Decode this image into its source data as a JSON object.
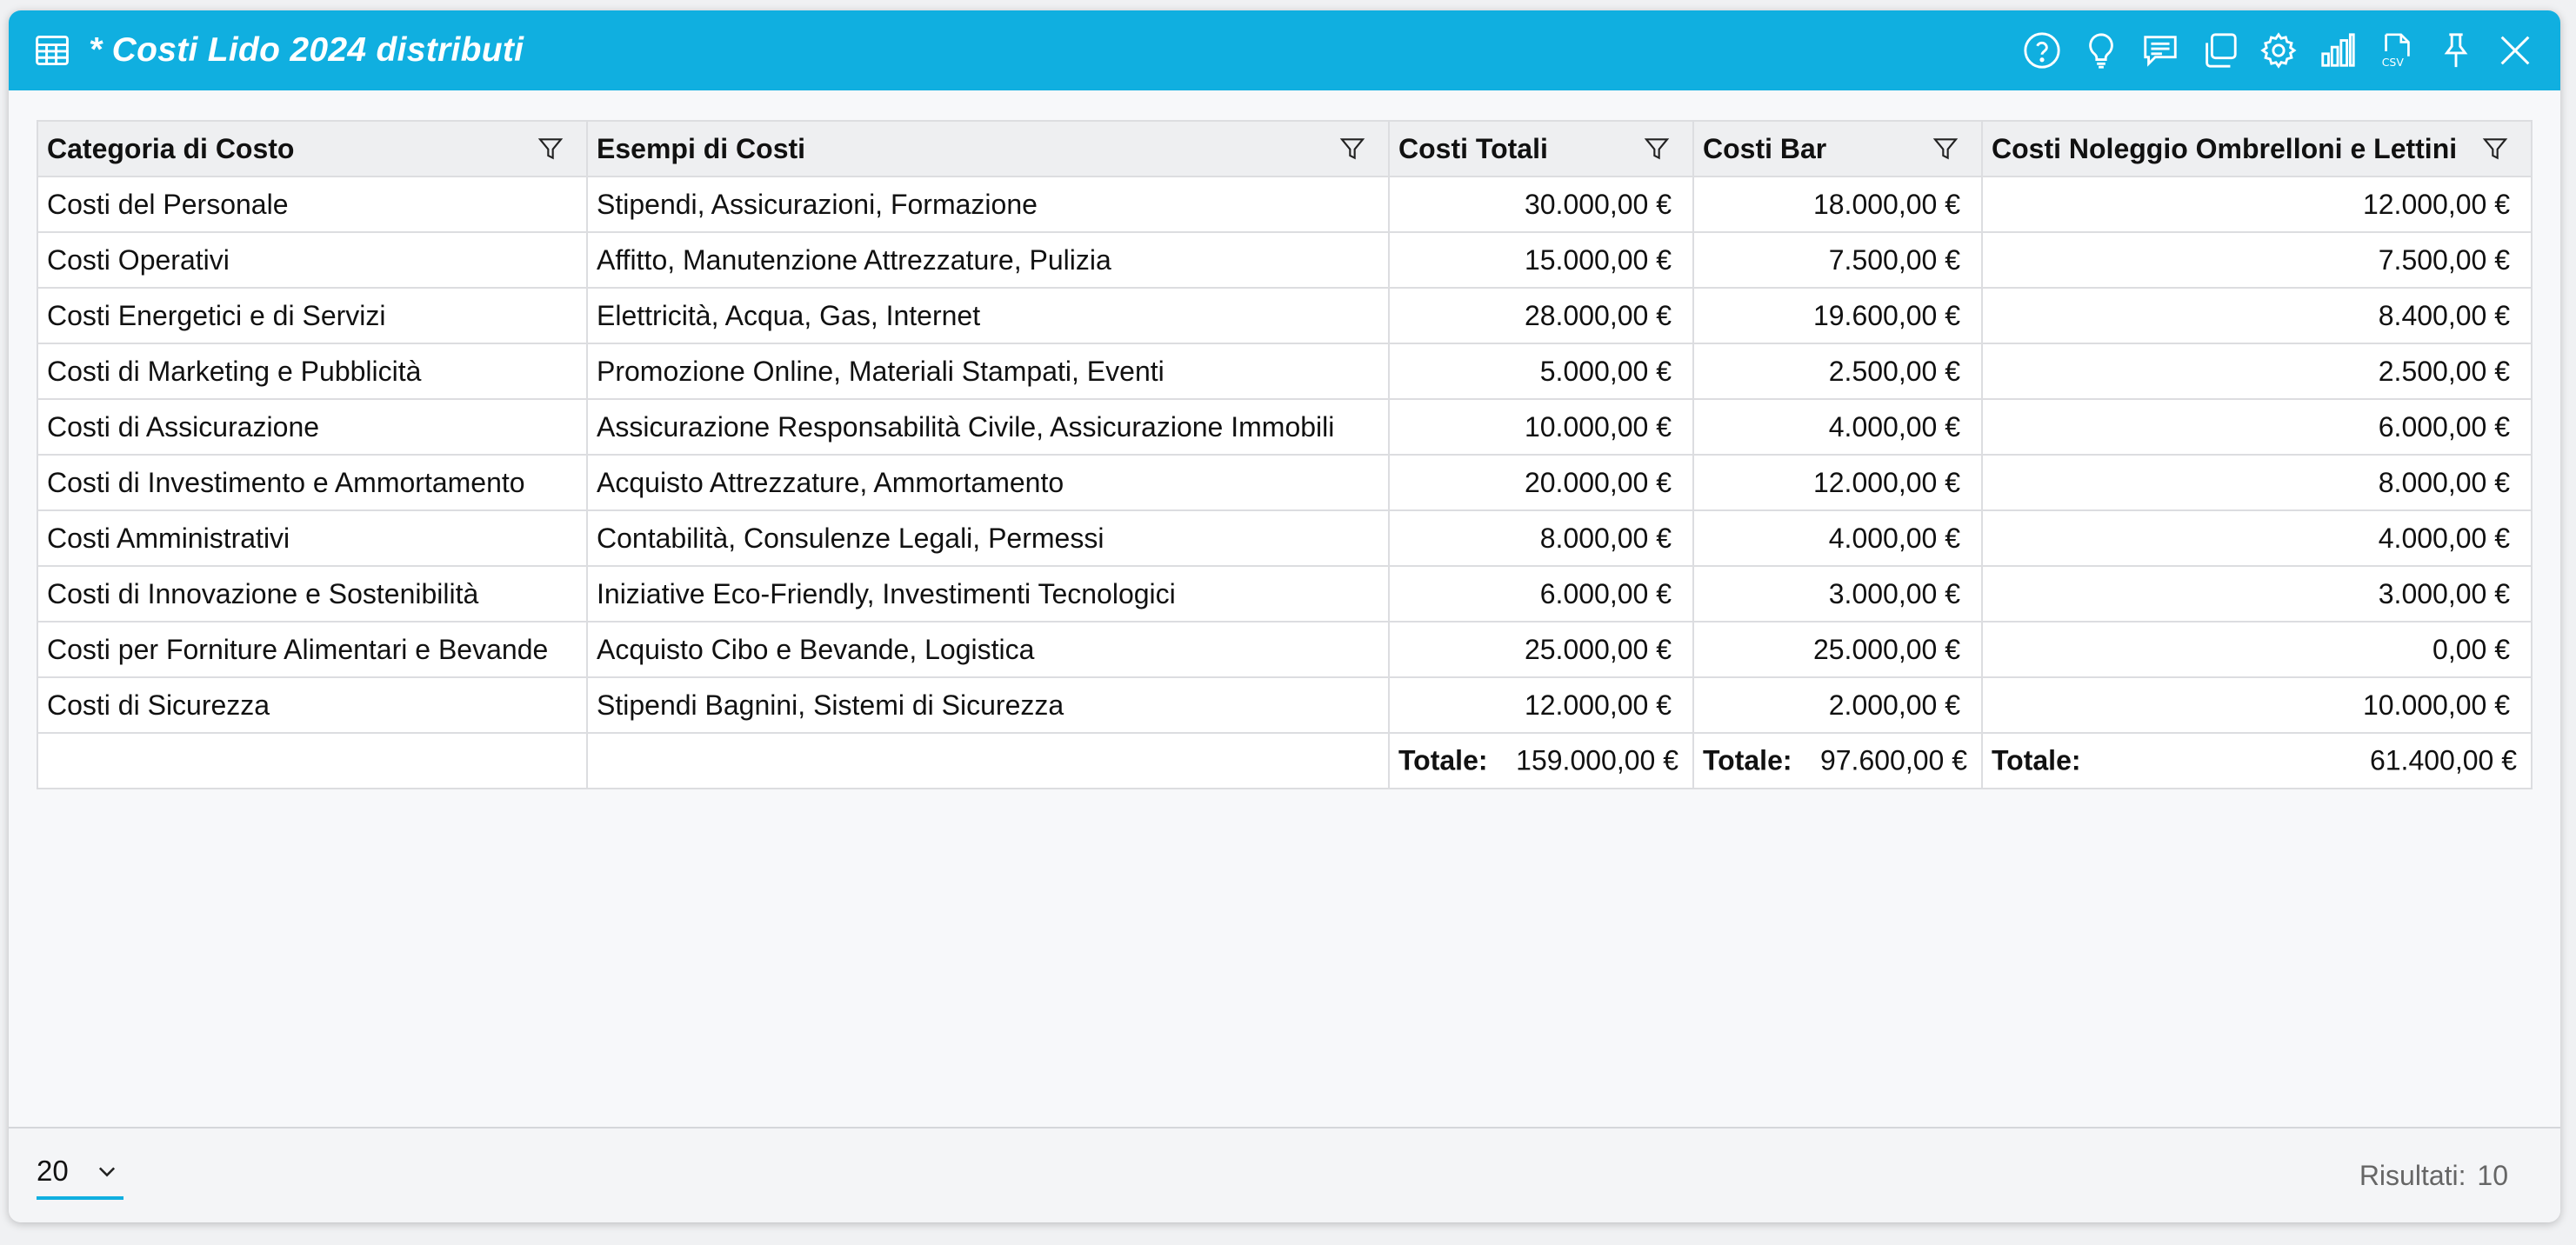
{
  "window": {
    "title": "* Costi Lido 2024 distributi",
    "toolbar_icons": [
      "help-circle-icon",
      "lightbulb-icon",
      "comment-icon",
      "copy-icon",
      "gear-icon",
      "bar-chart-icon",
      "csv-file-icon",
      "pin-icon",
      "close-icon"
    ]
  },
  "colors": {
    "accent": "#10afe0",
    "header_bg": "#eeeff1",
    "border": "#dcdde0"
  },
  "table": {
    "headers": [
      "Categoria di Costo",
      "Esempi di Costi",
      "Costi Totali",
      "Costi Bar",
      "Costi Noleggio Ombrelloni e Lettini"
    ],
    "rows": [
      [
        "Costi del Personale",
        "Stipendi, Assicurazioni, Formazione",
        "30.000,00 €",
        "18.000,00 €",
        "12.000,00 €"
      ],
      [
        "Costi Operativi",
        "Affitto, Manutenzione Attrezzature, Pulizia",
        "15.000,00 €",
        "7.500,00 €",
        "7.500,00 €"
      ],
      [
        "Costi Energetici e di Servizi",
        "Elettricità, Acqua, Gas, Internet",
        "28.000,00 €",
        "19.600,00 €",
        "8.400,00 €"
      ],
      [
        "Costi di Marketing e Pubblicità",
        "Promozione Online, Materiali Stampati, Eventi",
        "5.000,00 €",
        "2.500,00 €",
        "2.500,00 €"
      ],
      [
        "Costi di Assicurazione",
        "Assicurazione Responsabilità Civile, Assicurazione Immobili",
        "10.000,00 €",
        "4.000,00 €",
        "6.000,00 €"
      ],
      [
        "Costi di Investimento e Ammortamento",
        "Acquisto Attrezzature, Ammortamento",
        "20.000,00 €",
        "12.000,00 €",
        "8.000,00 €"
      ],
      [
        "Costi Amministrativi",
        "Contabilità, Consulenze Legali, Permessi",
        "8.000,00 €",
        "4.000,00 €",
        "4.000,00 €"
      ],
      [
        "Costi di Innovazione e Sostenibilità",
        "Iniziative Eco-Friendly, Investimenti Tecnologici",
        "6.000,00 €",
        "3.000,00 €",
        "3.000,00 €"
      ],
      [
        "Costi per Forniture Alimentari e Bevande",
        "Acquisto Cibo e Bevande, Logistica",
        "25.000,00 €",
        "25.000,00 €",
        "0,00 €"
      ],
      [
        "Costi di Sicurezza",
        "Stipendi Bagnini, Sistemi di Sicurezza",
        "12.000,00 €",
        "2.000,00 €",
        "10.000,00 €"
      ]
    ],
    "totals": {
      "label": "Totale:",
      "values": [
        "159.000,00 €",
        "97.600,00 €",
        "61.400,00 €"
      ]
    }
  },
  "footer": {
    "page_size": "20",
    "results_label": "Risultati:",
    "results_count": "10"
  }
}
